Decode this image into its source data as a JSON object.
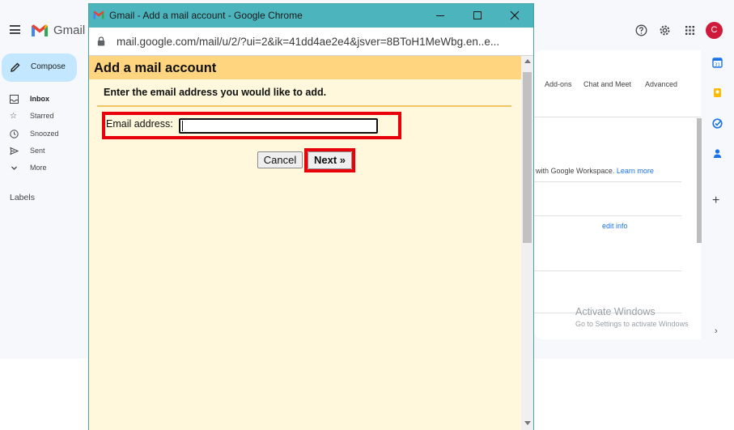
{
  "gmail": {
    "app_name": "Gmail",
    "compose_label": "Compose",
    "nav": [
      {
        "icon": "inbox-icon",
        "label": "Inbox"
      },
      {
        "icon": "star-icon",
        "label": "Starred"
      },
      {
        "icon": "clock-icon",
        "label": "Snoozed"
      },
      {
        "icon": "send-icon",
        "label": "Sent"
      },
      {
        "icon": "chevron-down-icon",
        "label": "More"
      }
    ],
    "labels_heading": "Labels",
    "avatar_letter": "C",
    "settings_tabs": [
      "Add-ons",
      "Chat and Meet",
      "Advanced"
    ],
    "workspace_text": "with Google Workspace.",
    "learn_more": "Learn more",
    "edit_info": "edit info",
    "activate_title": "Activate Windows",
    "activate_sub": "Go to Settings to activate Windows",
    "colors": {
      "compose_bg": "#c2e7ff",
      "avatar_bg": "#d01a3b",
      "link": "#1a73e8"
    }
  },
  "popup": {
    "window_title": "Gmail - Add a mail account - Google Chrome",
    "url": "mail.google.com/mail/u/2/?ui=2&ik=41dd4ae2e4&jsver=8BToH1MeWbg.en..e...",
    "heading": "Add a mail account",
    "instruction": "Enter the email address you would like to add.",
    "email_label": "Email address:",
    "email_value": "",
    "cancel_label": "Cancel",
    "next_label": "Next »",
    "colors": {
      "titlebar": "#4cb4bc",
      "header_bg": "#ffd57f",
      "body_bg": "#fff8dc",
      "highlight": "#e8000b"
    }
  }
}
